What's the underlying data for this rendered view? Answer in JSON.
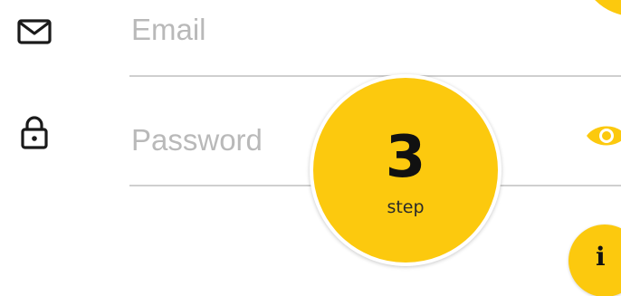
{
  "form": {
    "email": {
      "placeholder": "Email",
      "value": "",
      "icon": "mail-icon"
    },
    "password": {
      "placeholder": "Password",
      "value": "",
      "icon": "lock-icon",
      "toggle_icon": "eye-icon"
    }
  },
  "step_badge": {
    "number": "3",
    "label": "step"
  },
  "info_button": {
    "glyph": "i",
    "icon": "info-icon"
  },
  "colors": {
    "accent": "#fcc90e",
    "placeholder": "#b9b9b9",
    "divider": "#cfcfcf",
    "icon": "#1a1a1a"
  }
}
